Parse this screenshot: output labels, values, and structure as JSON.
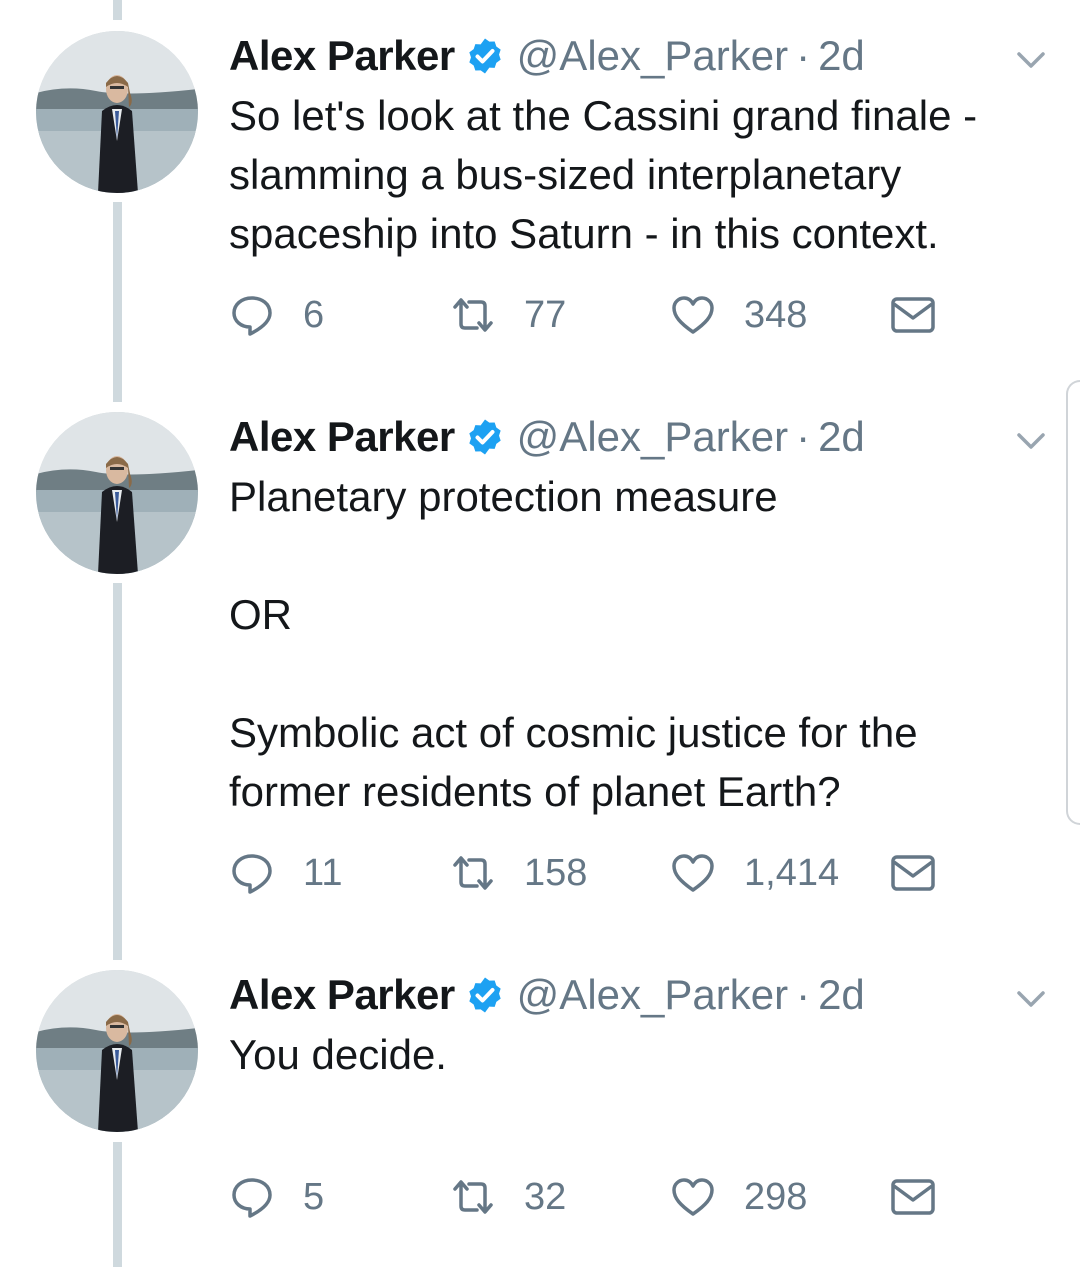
{
  "tweets": [
    {
      "name": "Alex Parker",
      "handle": "@Alex_Parker",
      "separator": "·",
      "time": "2d",
      "text": "So let's look at the Cassini grand finale - slamming a bus-sized interplanetary spaceship into Saturn - in this context.",
      "replies": "6",
      "retweets": "77",
      "likes": "348"
    },
    {
      "name": "Alex Parker",
      "handle": "@Alex_Parker",
      "separator": "·",
      "time": "2d",
      "text": "Planetary protection measure\n\nOR\n\nSymbolic act of cosmic justice for the former residents of planet Earth?",
      "replies": "11",
      "retweets": "158",
      "likes": "1,414"
    },
    {
      "name": "Alex Parker",
      "handle": "@Alex_Parker",
      "separator": "·",
      "time": "2d",
      "text": "You decide.",
      "replies": "5",
      "retweets": "32",
      "likes": "298"
    }
  ],
  "colors": {
    "text_primary": "#14171a",
    "text_secondary": "#657786",
    "verified_blue": "#1da1f2",
    "thread_line": "#cfd9de"
  },
  "icons": {
    "verified": "verified-badge-icon",
    "menu": "chevron-down-icon",
    "reply": "reply-icon",
    "retweet": "retweet-icon",
    "like": "heart-icon",
    "dm": "envelope-icon"
  }
}
